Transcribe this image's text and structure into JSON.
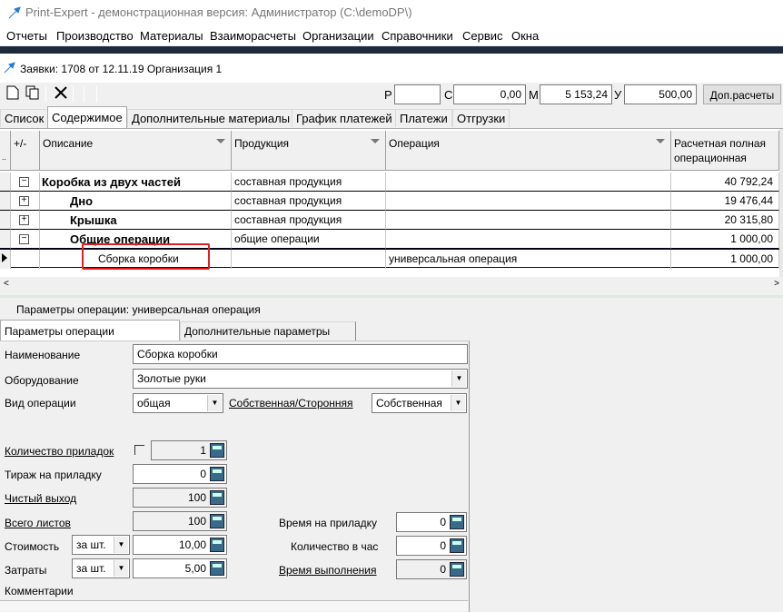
{
  "window": {
    "title": "Print-Expert - демонстрационная версия: Администратор (C:\\demoDP\\)"
  },
  "menu": [
    "Отчеты",
    "Производство",
    "Материалы",
    "Взаиморасчеты",
    "Организации",
    "Справочники",
    "Сервис",
    "Окна"
  ],
  "document": {
    "title": "Заявки: 1708 от 12.11.19  Организация 1"
  },
  "summary": {
    "r_label": "Р",
    "r_value": "",
    "c_label": "С",
    "c_value": "0,00",
    "m_label": "М",
    "m_value": "5 153,24",
    "u_label": "У",
    "u_value": "500,00",
    "extra_button": "Доп.расчеты"
  },
  "tabs": [
    "Список",
    "Содержимое",
    "Дополнительные материалы",
    "График платежей",
    "Платежи",
    "Отгрузки"
  ],
  "grid": {
    "headers": {
      "expand": "+/-",
      "desc": "Описание",
      "product": "Продукция",
      "operation": "Операция",
      "cost_line1": "Расчетная полная",
      "cost_line2": "операционная"
    },
    "rows": [
      {
        "pm": "−",
        "desc": "Коробка из двух частей",
        "product": "составная продукция",
        "operation": "",
        "cost": "40 792,24"
      },
      {
        "pm": "+",
        "desc": "Дно",
        "product": "составная продукция",
        "operation": "",
        "cost": "19 476,44"
      },
      {
        "pm": "+",
        "desc": "Крышка",
        "product": "составная продукция",
        "operation": "",
        "cost": "20 315,80"
      },
      {
        "pm": "−",
        "desc": "Общие операции",
        "product": "общие операции",
        "operation": "",
        "cost": "1 000,00"
      },
      {
        "pm": "",
        "desc": "Сборка коробки",
        "product": "",
        "operation": "универсальная операция",
        "cost": "1 000,00"
      }
    ]
  },
  "params": {
    "title": "Параметры операции: универсальная операция",
    "tabs": [
      "Параметры операции",
      "Дополнительные параметры"
    ],
    "name_label": "Наименование",
    "name_value": "Сборка коробки",
    "equipment_label": "Оборудование",
    "equipment_value": "Золотые руки",
    "optype_label": "Вид операции",
    "optype_value": "общая",
    "own_label": "Собственная/Сторонняя",
    "own_value": "Собственная",
    "qty_label": "Количество приладок",
    "qty_value": "1",
    "run_label": "Тираж на приладку",
    "run_value": "0",
    "net_label": "Чистый выход",
    "net_value": "100",
    "sheets_label": "Всего листов",
    "sheets_value": "100",
    "cost_label": "Стоимость",
    "cost_unit": "за шт.",
    "cost_value": "10,00",
    "expense_label": "Затраты",
    "expense_unit": "за шт.",
    "expense_value": "5,00",
    "setup_time_label": "Время на приладку",
    "setup_time_value": "0",
    "per_hour_label": "Количество в час",
    "per_hour_value": "0",
    "exec_time_label": "Время выполнения",
    "exec_time_value": "0",
    "comments_label": "Комментарии"
  },
  "colors": {
    "highlight": "#e02020",
    "darkbar": "#1c2a3c",
    "selected_row_border": "#000080"
  }
}
